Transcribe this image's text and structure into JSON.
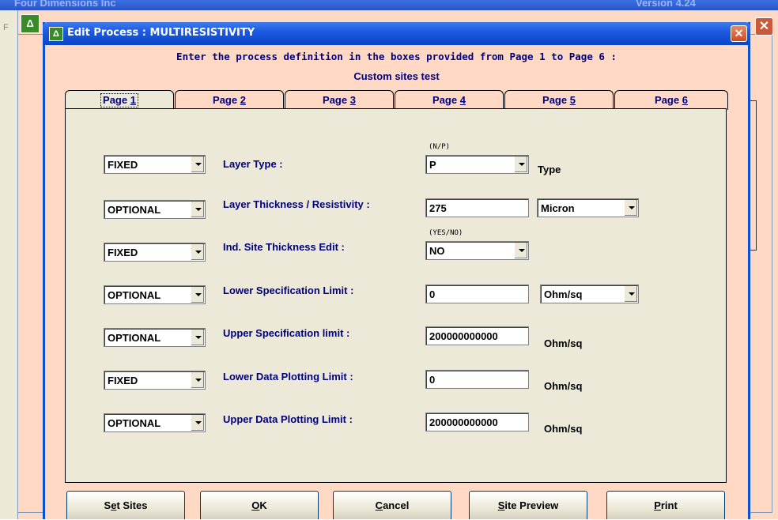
{
  "background_app": {
    "title": "Four Dimensions Inc",
    "version": "Version 4.24",
    "close_glyph": "✕",
    "left_letter": "F"
  },
  "dialog": {
    "title": "Edit Process : MULTIRESISTIVITY",
    "close_glyph": "✕",
    "instruction": "Enter the process definition in the boxes provided from Page 1 to Page 6 :",
    "subtitle": "Custom sites test"
  },
  "tabs": [
    {
      "prefix": "Page ",
      "key": "1",
      "active": true
    },
    {
      "prefix": "Page ",
      "key": "2",
      "active": false
    },
    {
      "prefix": "Page ",
      "key": "3",
      "active": false
    },
    {
      "prefix": "Page ",
      "key": "4",
      "active": false
    },
    {
      "prefix": "Page ",
      "key": "5",
      "active": false
    },
    {
      "prefix": "Page ",
      "key": "6",
      "active": false
    }
  ],
  "rows": [
    {
      "mode": "FIXED",
      "label": "Layer Type :",
      "hint": "(N/P)",
      "value": "P",
      "suffix": "Type"
    },
    {
      "mode": "OPTIONAL",
      "label": "Layer Thickness / Resistivity :",
      "value": "275",
      "unit_select": "Micron"
    },
    {
      "mode": "FIXED",
      "label": "Ind. Site Thickness Edit :",
      "hint": "(YES/NO)",
      "value": "NO"
    },
    {
      "mode": "OPTIONAL",
      "label": "Lower Specification Limit :",
      "value": "0",
      "unit_select": "Ohm/sq"
    },
    {
      "mode": "OPTIONAL",
      "label": "Upper Specification limit :",
      "value": "200000000000",
      "suffix": "Ohm/sq"
    },
    {
      "mode": "FIXED",
      "label": "Lower Data Plotting Limit :",
      "value": "0",
      "suffix": "Ohm/sq"
    },
    {
      "mode": "OPTIONAL",
      "label": "Upper Data Plotting Limit :",
      "value": "200000000000",
      "suffix": "Ohm/sq"
    }
  ],
  "buttons": [
    {
      "pre": "S",
      "key": "e",
      "post": "t Sites"
    },
    {
      "pre": "",
      "key": "O",
      "post": "K"
    },
    {
      "pre": "",
      "key": "C",
      "post": "ancel"
    },
    {
      "pre": "",
      "key": "S",
      "post": "ite Preview"
    },
    {
      "pre": "",
      "key": "P",
      "post": "rint"
    }
  ],
  "colors": {
    "accent": "#00007f",
    "dialog_bg": "#ffd9c4",
    "panel_bg": "#ece9d8",
    "titlebar": "#0a46c8"
  }
}
